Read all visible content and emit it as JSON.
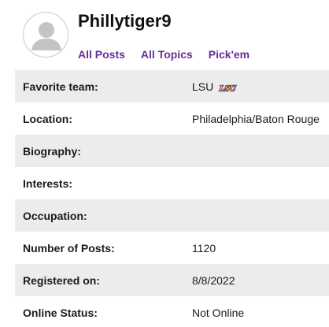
{
  "header": {
    "username": "Phillytiger9",
    "nav": [
      {
        "label": "All Posts"
      },
      {
        "label": "All Topics"
      },
      {
        "label": "Pick'em"
      }
    ]
  },
  "profile": {
    "rows": [
      {
        "label": "Favorite team:",
        "value": "LSU",
        "logo": "lsu-logo"
      },
      {
        "label": "Location:",
        "value": "Philadelphia/Baton Rouge"
      },
      {
        "label": "Biography:",
        "value": ""
      },
      {
        "label": "Interests:",
        "value": ""
      },
      {
        "label": "Occupation:",
        "value": ""
      },
      {
        "label": "Number of Posts:",
        "value": "1120"
      },
      {
        "label": "Registered on:",
        "value": "8/8/2022"
      },
      {
        "label": "Online Status:",
        "value": "Not Online"
      }
    ]
  },
  "colors": {
    "link": "#6a2d9a",
    "row_shade": "#ececec",
    "lsu_purple": "#461d7c",
    "lsu_gold": "#fdd023"
  }
}
